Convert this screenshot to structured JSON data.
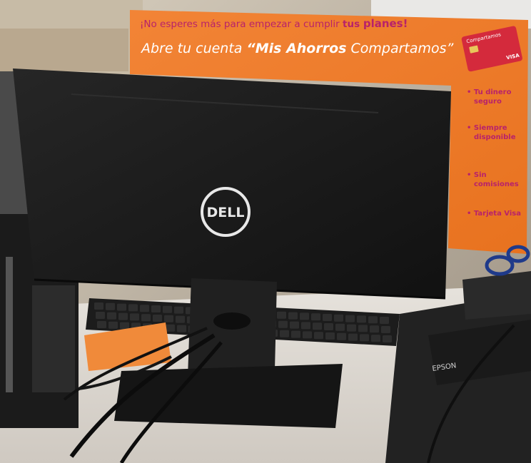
{
  "sign": {
    "headline_prefix": "¡No esperes más para empezar a cumplir ",
    "headline_tus": "tus ",
    "headline_planes": "planes!",
    "tagline_lead": "Abre tu cuenta ",
    "tagline_product": "“Mis Ahorros",
    "tagline_brand": " Compartamos”",
    "card_brand": "Compartamos",
    "card_visa": "VISA",
    "benefits": [
      {
        "line1": "• Tu dinero",
        "line2": "seguro"
      },
      {
        "line1": "• Siempre",
        "line2": "disponible"
      },
      {
        "line1": "• Sin",
        "line2": "comisiones"
      },
      {
        "line1": "• Tarjeta Visa",
        "line2": ""
      }
    ]
  },
  "monitor": {
    "logo": "DELL"
  },
  "printer": {
    "label": "EPSON"
  },
  "colors": {
    "sign_orange": "#f07a2a",
    "sign_text_magenta": "#b8226a",
    "card_red": "#d42a3c",
    "monitor_black": "#1a1a1a"
  }
}
